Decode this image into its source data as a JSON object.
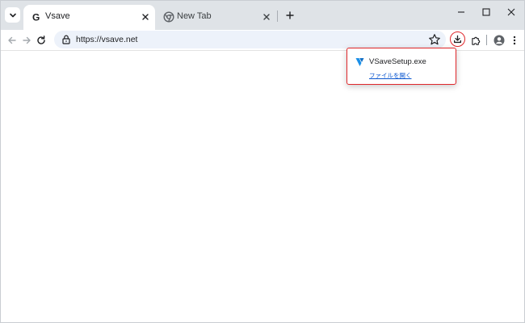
{
  "browser": {
    "tabs": [
      {
        "title": "Vsave",
        "favicon": "google-g-icon",
        "active": true
      },
      {
        "title": "New Tab",
        "favicon": "chrome-icon",
        "active": false
      }
    ]
  },
  "omnibox": {
    "url": "https://vsave.net"
  },
  "download_popup": {
    "filename": "VSaveSetup.exe",
    "open_file_label": "ファイルを開く"
  },
  "colors": {
    "highlight": "#e0272b",
    "link": "#0b57d0",
    "tabstrip": "#dfe3e7",
    "omnibox": "#edf2fa"
  },
  "icons": {
    "tab_search": "chevron-down-icon",
    "close_tab": "close-icon",
    "new_tab": "plus-icon",
    "minimize": "minimize-icon",
    "maximize": "maximize-icon",
    "close_window": "close-icon",
    "back": "back-arrow-icon",
    "forward": "forward-arrow-icon",
    "reload": "reload-icon",
    "site_info": "lock-icon",
    "bookmark": "star-icon",
    "downloads": "download-icon",
    "extensions": "puzzle-icon",
    "profile": "profile-icon",
    "menu": "kebab-menu-icon",
    "download_file": "vsave-logo-icon"
  }
}
